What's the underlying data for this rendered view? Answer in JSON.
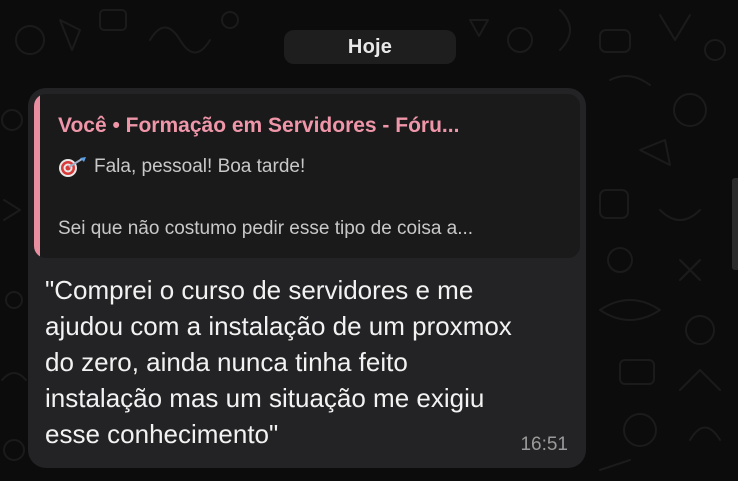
{
  "chat": {
    "date_separator": "Hoje"
  },
  "message": {
    "quote": {
      "author_label": "Você • Formação em Servidores - Fóru...",
      "line1": "Fala, pessoal! Boa tarde!",
      "line2": "Sei que não costumo pedir esse tipo de coisa a...",
      "emoji": "target-dart-icon"
    },
    "text": "\"Comprei o curso de servidores e me\najudou com a instalação de um proxmox\ndo zero, ainda nunca tinha feito\ninstalação mas um situação me exigiu\nesse conhecimento\"",
    "time": "16:51"
  },
  "colors": {
    "background": "#0c0c0c",
    "bubble": "#232325",
    "quote_background": "#1a1a1b",
    "quote_accent": "#e98ea1",
    "author_text": "#ef96a9"
  }
}
